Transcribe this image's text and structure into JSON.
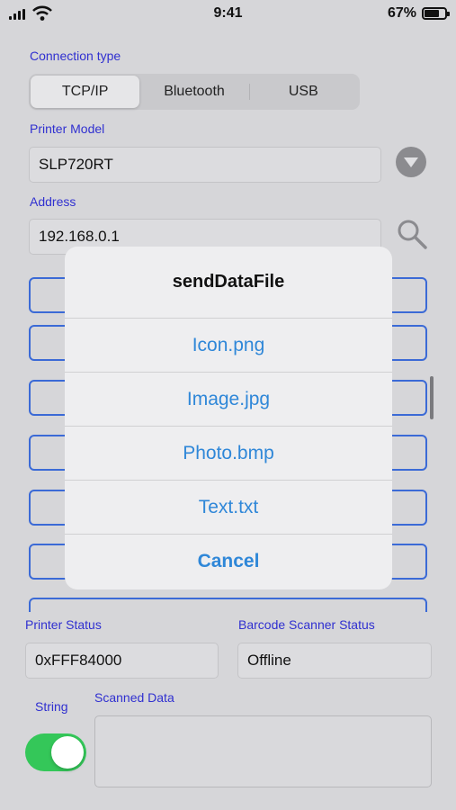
{
  "status_bar": {
    "time": "9:41",
    "battery_percent": "67%",
    "battery_level": 0.67
  },
  "connection": {
    "label": "Connection type",
    "segments": [
      "TCP/IP",
      "Bluetooth",
      "USB"
    ],
    "selected": "TCP/IP"
  },
  "printer_model": {
    "label": "Printer Model",
    "value": "SLP720RT"
  },
  "address": {
    "label": "Address",
    "value": "192.168.0.1"
  },
  "dialog": {
    "title": "sendDataFile",
    "options": [
      "Icon.png",
      "Image.jpg",
      "Photo.bmp",
      "Text.txt"
    ],
    "cancel": "Cancel"
  },
  "printer_status": {
    "label": "Printer Status",
    "value": "0xFFF84000"
  },
  "barcode_status": {
    "label": "Barcode Scanner Status",
    "value": "Offline"
  },
  "string_toggle": {
    "label": "String",
    "on": true
  },
  "scanned": {
    "label": "Scanned Data",
    "value": ""
  },
  "colors": {
    "accent": "#2f87d8",
    "label_blue": "#3030d0",
    "toggle_on": "#34c759"
  }
}
